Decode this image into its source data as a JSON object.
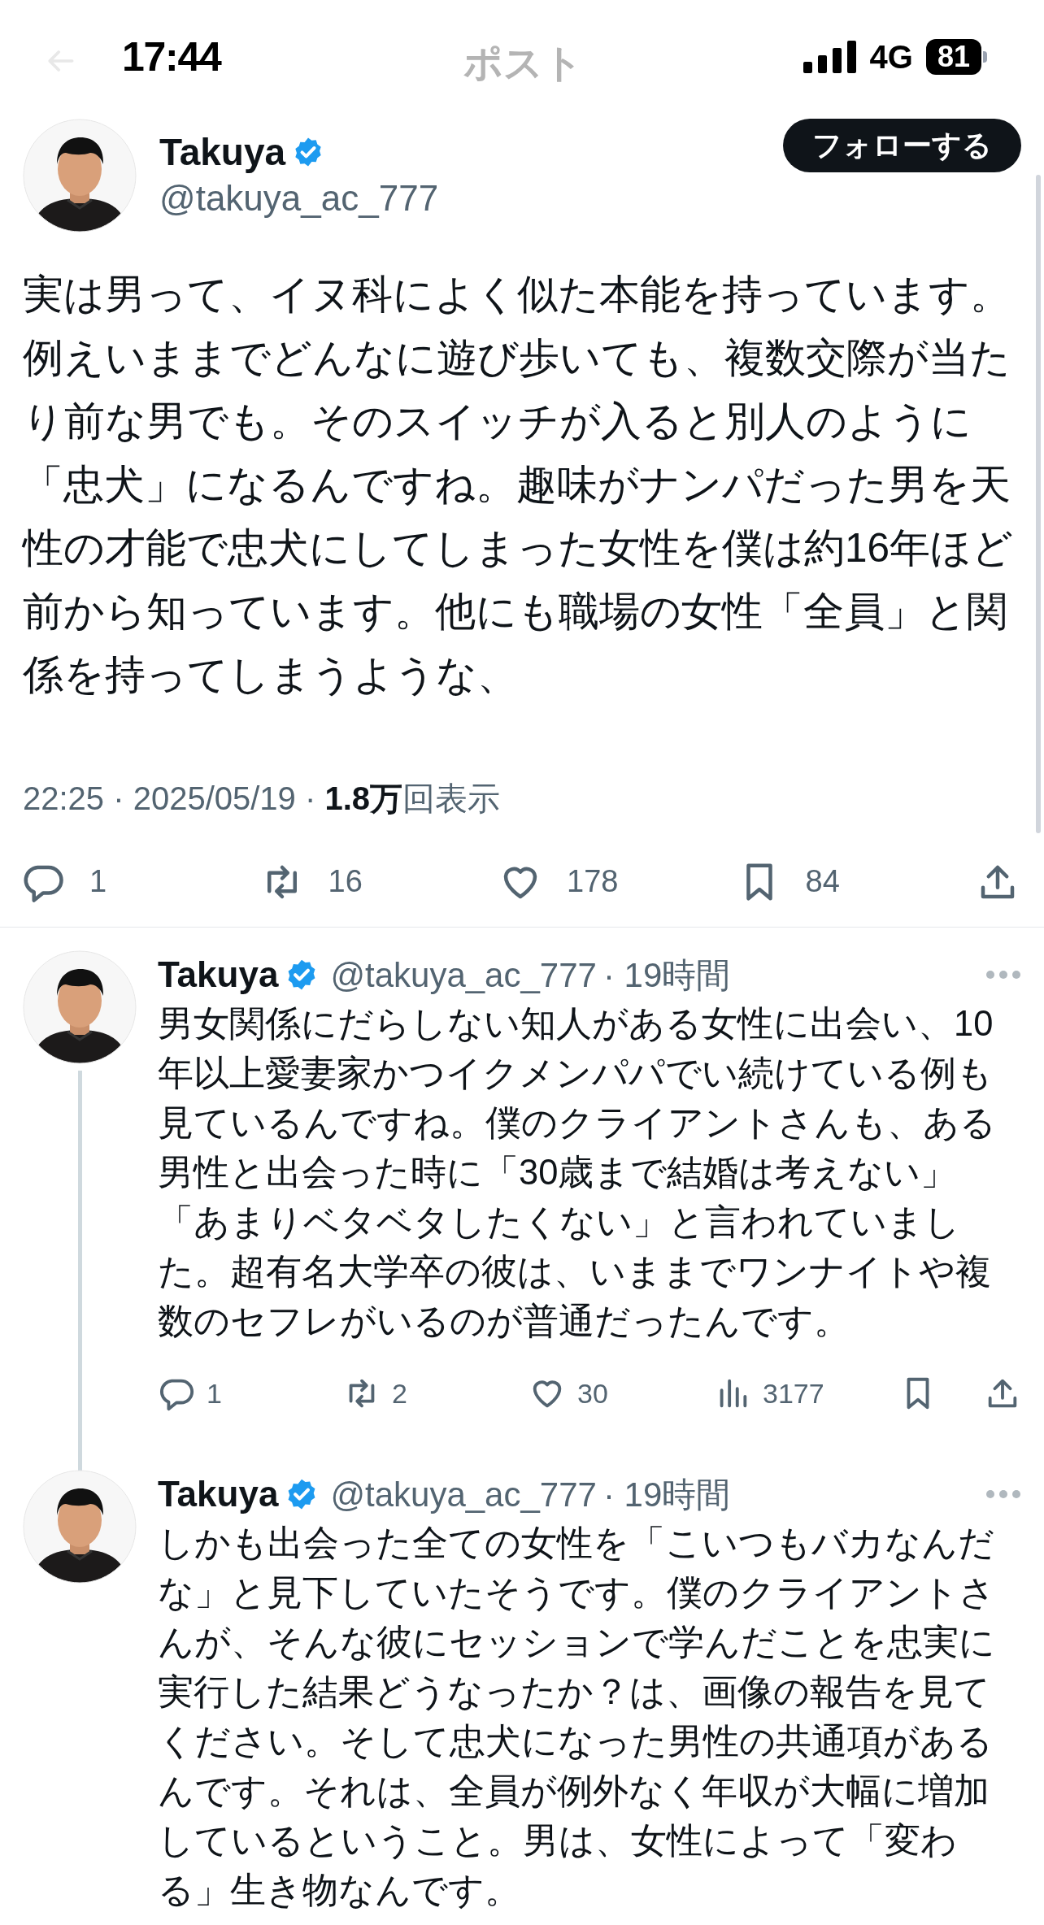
{
  "status_bar": {
    "time": "17:44",
    "network": "4G",
    "battery": "81"
  },
  "header": {
    "title": "ポスト"
  },
  "main_post": {
    "author": {
      "name": "Takuya",
      "verified": true,
      "handle": "@takuya_ac_777"
    },
    "follow_button": "フォローする",
    "text": "実は男って、イヌ科によく似た本能を持っています。例えいままでどんなに遊び歩いても、複数交際が当たり前な男でも。そのスイッチが入ると別人のように「忠犬」になるんですね。趣味がナンパだった男を天性の才能で忠犬にしてしまった女性を僕は約16年ほど前から知っています。他にも職場の女性「全員」と関係を持ってしまうような、",
    "meta": "22:25 · 2025/05/19 · **1.8万**回表示",
    "actions": [
      {
        "kind": "reply",
        "count": "1"
      },
      {
        "kind": "repost",
        "count": "16"
      },
      {
        "kind": "like",
        "count": "178"
      },
      {
        "kind": "bookmark",
        "count": "84"
      },
      {
        "kind": "share"
      }
    ]
  },
  "replies": [
    {
      "author": {
        "name": "Takuya",
        "verified": true,
        "handle": "@takuya_ac_777"
      },
      "time": "· 19時間",
      "thread_continues": true,
      "text": "男女関係にだらしない知人がある女性に出会い、10年以上愛妻家かつイクメンパパでい続けている例も見ているんですね。僕のクライアントさんも、ある男性と出会った時に「30歳まで結婚は考えない」「あまりベタベタしたくない」と言われていました。超有名大学卒の彼は、いままでワンナイトや複数のセフレがいるのが普通だったんです。",
      "actions": [
        {
          "kind": "reply",
          "count": "1"
        },
        {
          "kind": "repost",
          "count": "2"
        },
        {
          "kind": "like",
          "count": "30"
        },
        {
          "kind": "views",
          "count": "3177"
        },
        {
          "kind": "bookmark"
        },
        {
          "kind": "share"
        }
      ]
    },
    {
      "author": {
        "name": "Takuya",
        "verified": true,
        "handle": "@takuya_ac_777"
      },
      "time": "· 19時間",
      "thread_continues": false,
      "text": "しかも出会った全ての女性を「こいつもバカなんだな」と見下していたそうです。僕のクライアントさんが、そんな彼にセッションで学んだことを忠実に実行した結果どうなったか？は、画像の報告を見てください。そして忠犬になった男性の共通項があるんです。それは、全員が例外なく年収が大幅に増加しているということ。男は、女性によって「変わる」生き物なんです。"
    }
  ]
}
